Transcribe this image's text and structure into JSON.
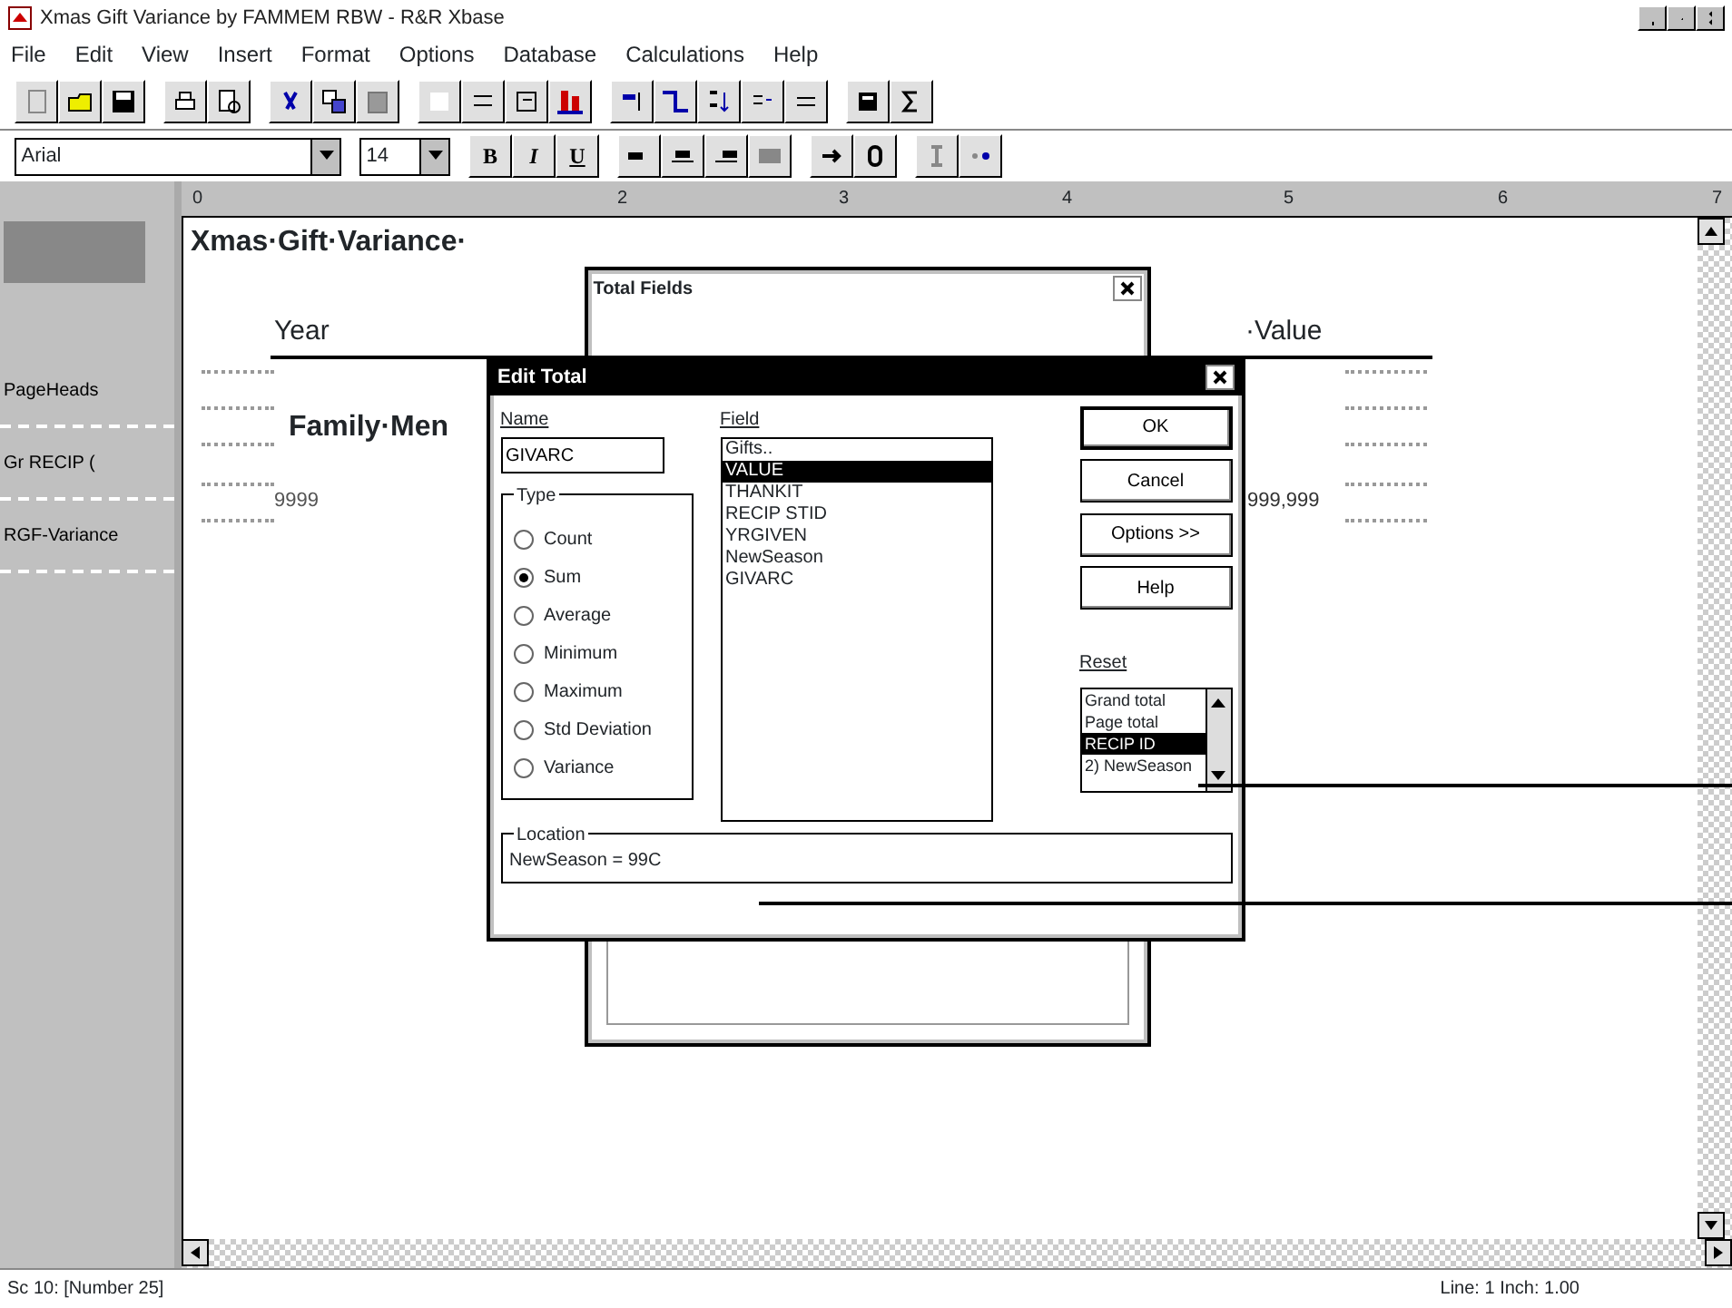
{
  "window": {
    "title": "Xmas Gift Variance by FAMMEM RBW - R&R Xbase"
  },
  "menu": [
    "File",
    "Edit",
    "View",
    "Insert",
    "Format",
    "Options",
    "Database",
    "Calculations",
    "Help"
  ],
  "format_bar": {
    "font": "Arial",
    "size": "14",
    "style_buttons": [
      "B",
      "I",
      "U"
    ]
  },
  "ruler": [
    "0",
    "2",
    "3",
    "4",
    "5",
    "6",
    "7"
  ],
  "bands": [
    {
      "label": "PageHeads"
    },
    {
      "label": "Gr RECIP ("
    },
    {
      "label": "RGF-Variance"
    }
  ],
  "report": {
    "title": "Xmas·Gift·Variance·",
    "year": "Year",
    "value": "·Value",
    "family": "Family·Men",
    "year_field": "9999",
    "value_field": "999,999"
  },
  "total_fields_dialog": {
    "title": "Total Fields"
  },
  "edit_total": {
    "title": "Edit Total",
    "name_label": "Name",
    "name_value": "GIVARC",
    "field_label": "Field",
    "fields": [
      {
        "label": "Gifts..",
        "selected": false
      },
      {
        "label": "VALUE",
        "selected": true
      },
      {
        "label": "THANKIT",
        "selected": false
      },
      {
        "label": "RECIP STID",
        "selected": false
      },
      {
        "label": "YRGIVEN",
        "selected": false
      },
      {
        "label": "NewSeason",
        "selected": false
      },
      {
        "label": "GIVARC",
        "selected": false
      }
    ],
    "type_label": "Type",
    "types": [
      {
        "label": "Count",
        "selected": false
      },
      {
        "label": "Sum",
        "selected": true
      },
      {
        "label": "Average",
        "selected": false
      },
      {
        "label": "Minimum",
        "selected": false
      },
      {
        "label": "Maximum",
        "selected": false
      },
      {
        "label": "Std Deviation",
        "selected": false
      },
      {
        "label": "Variance",
        "selected": false
      }
    ],
    "buttons": [
      {
        "label": "OK",
        "default": true
      },
      {
        "label": "Cancel",
        "default": false
      },
      {
        "label": "Options >>",
        "default": false
      },
      {
        "label": "Help",
        "default": false
      }
    ],
    "reset_label": "Reset",
    "reset_items": [
      {
        "label": "Grand total",
        "selected": false
      },
      {
        "label": "Page total",
        "selected": false
      },
      {
        "label": "RECIP ID",
        "selected": true
      },
      {
        "label": "2) NewSeason",
        "selected": false
      }
    ],
    "location_label": "Location",
    "location_value": "NewSeason = 99C"
  },
  "status_bar": {
    "left": "Sc 10: [Number 25]",
    "right": "Line: 1  Inch: 1.00"
  }
}
